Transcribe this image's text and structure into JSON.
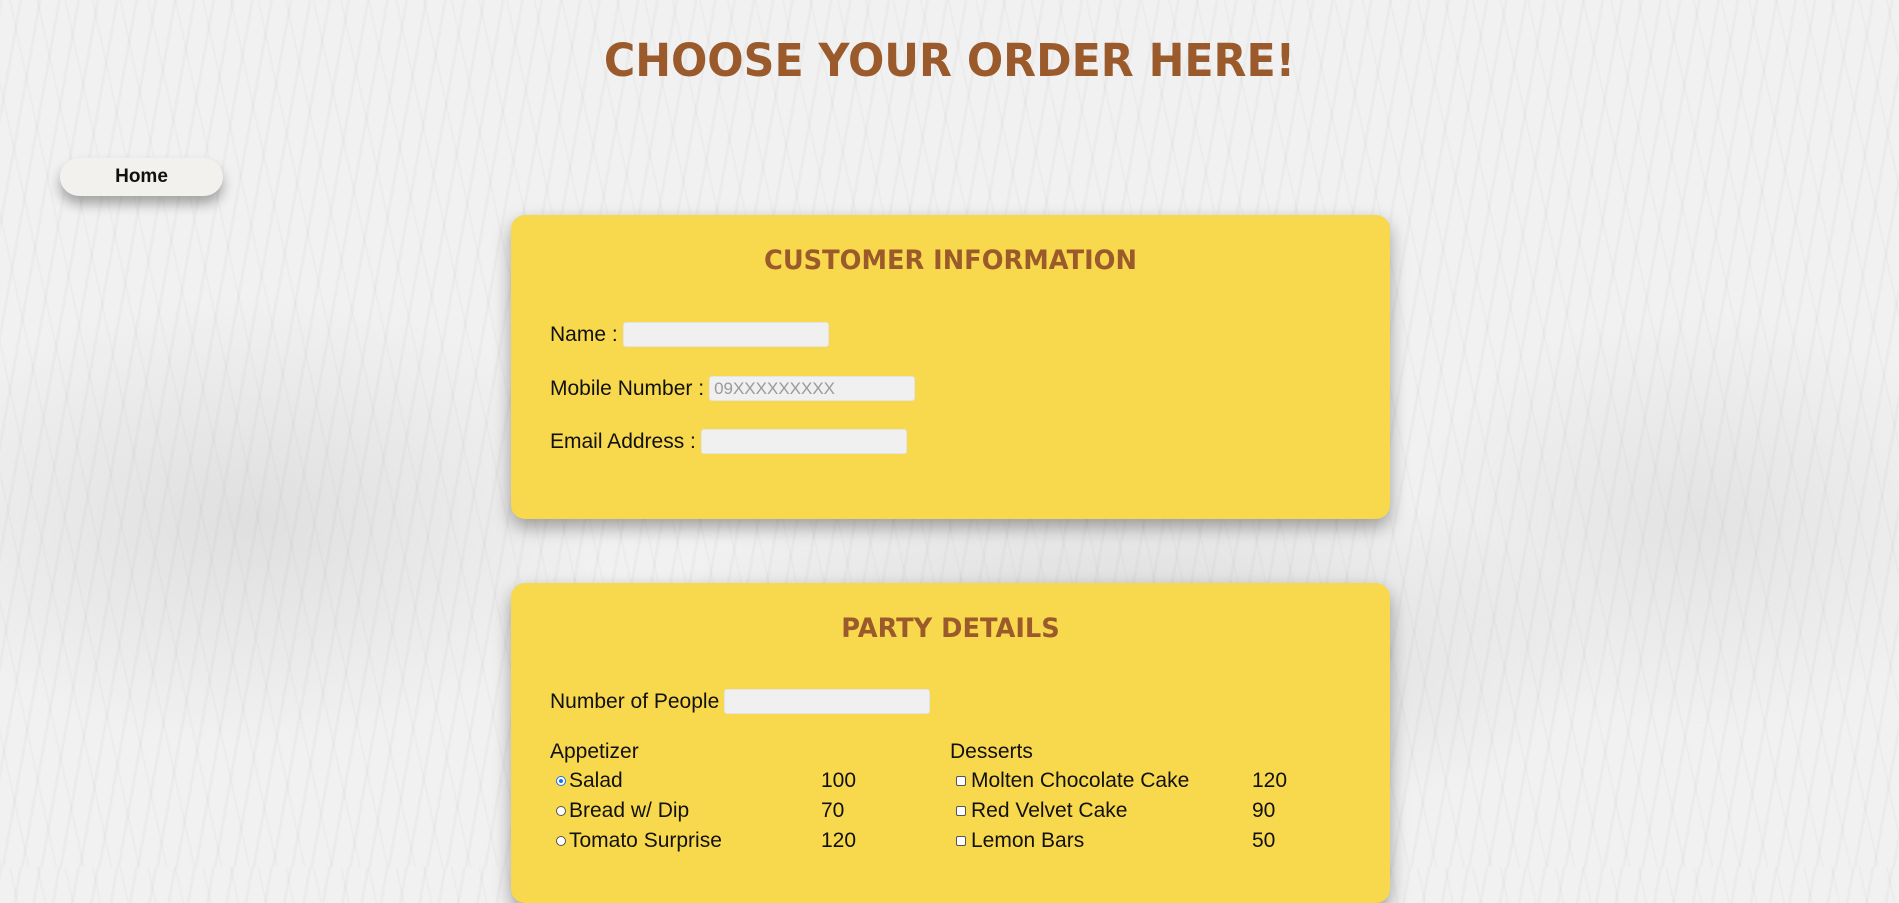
{
  "page": {
    "title": "CHOOSE YOUR ORDER HERE!"
  },
  "nav": {
    "home_label": "Home"
  },
  "customer_info": {
    "heading": "CUSTOMER INFORMATION",
    "name_label": "Name :",
    "name_value": "",
    "mobile_label": "Mobile Number :",
    "mobile_placeholder": "09XXXXXXXXX",
    "mobile_value": "",
    "email_label": "Email Address :",
    "email_value": ""
  },
  "party_details": {
    "heading": "PARTY DETAILS",
    "people_label": "Number of People",
    "people_value": "",
    "appetizer": {
      "heading": "Appetizer",
      "control": "radio",
      "items": [
        {
          "name": "Salad",
          "price": "100",
          "selected": true
        },
        {
          "name": "Bread w/ Dip",
          "price": "70",
          "selected": false
        },
        {
          "name": "Tomato Surprise",
          "price": "120",
          "selected": false
        }
      ]
    },
    "desserts": {
      "heading": "Desserts",
      "control": "checkbox",
      "items": [
        {
          "name": "Molten Chocolate Cake",
          "price": "120",
          "selected": false
        },
        {
          "name": "Red Velvet Cake",
          "price": "90",
          "selected": false
        },
        {
          "name": "Lemon Bars",
          "price": "50",
          "selected": false
        }
      ]
    }
  },
  "colors": {
    "card_background": "#f8d84d",
    "heading_brown": "#9a5a2c",
    "radio_selected": "#1a73e8",
    "page_background": "#f1f1f1"
  }
}
